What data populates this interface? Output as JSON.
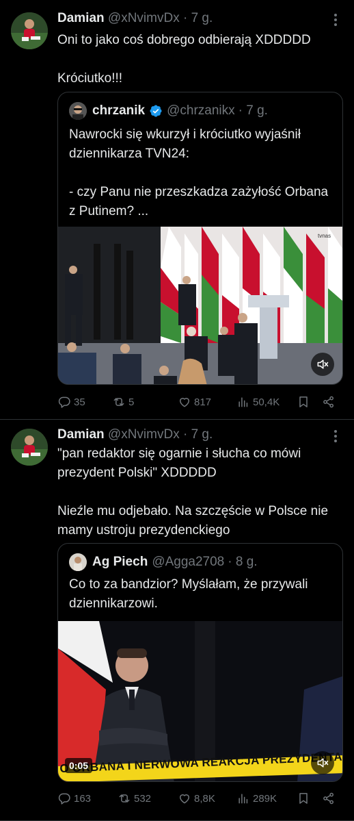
{
  "tweets": [
    {
      "author_name": "Damian",
      "author_handle": "@xNvimvDx",
      "time": "· 7 g.",
      "text": "Oni to jako coś dobrego odbierają XDDDDD\n\nKróciutko!!!",
      "quote": {
        "author_name": "chrzanik",
        "verified": true,
        "author_handle": "@chrzanikx",
        "time": "· 7 g.",
        "text": "Nawrocki się wkurzył i króciutko wyjaśnił dziennikarza TVN24:\n\n- czy Panu nie przeszkadza zażyłość Orbana z Putinem? ...",
        "media_watermark": "tvnas",
        "muted_icon": "speaker-muted-icon"
      },
      "stats": {
        "replies": "35",
        "retweets": "5",
        "likes": "817",
        "views": "50,4K"
      }
    },
    {
      "author_name": "Damian",
      "author_handle": "@xNvimvDx",
      "time": "· 7 g.",
      "text": "\"pan redaktor się ogarnie i słucha co mówi prezydent Polski\" XDDDDD\n\nNieźle mu odjebało. Na szczęście w Polsce nie mamy ustroju prezydenckiego",
      "quote": {
        "author_name": "Ag Piech",
        "verified": false,
        "author_handle": "@Agga2708",
        "time": "· 8 g.",
        "text": "Co to za bandzior? Myślałam, że przywali dziennikarzowi.",
        "video_time": "0:05",
        "caption": "O ORBANA I NERWOWA REAKCJA PREZYDENTA",
        "muted_icon": "speaker-muted-icon"
      },
      "stats": {
        "replies": "163",
        "retweets": "532",
        "likes": "8,8K",
        "views": "289K"
      }
    }
  ],
  "colors": {
    "background": "#000000",
    "text": "#e7e9ea",
    "muted": "#71767b",
    "border": "#2f3336",
    "verified": "#1d9bf0"
  }
}
